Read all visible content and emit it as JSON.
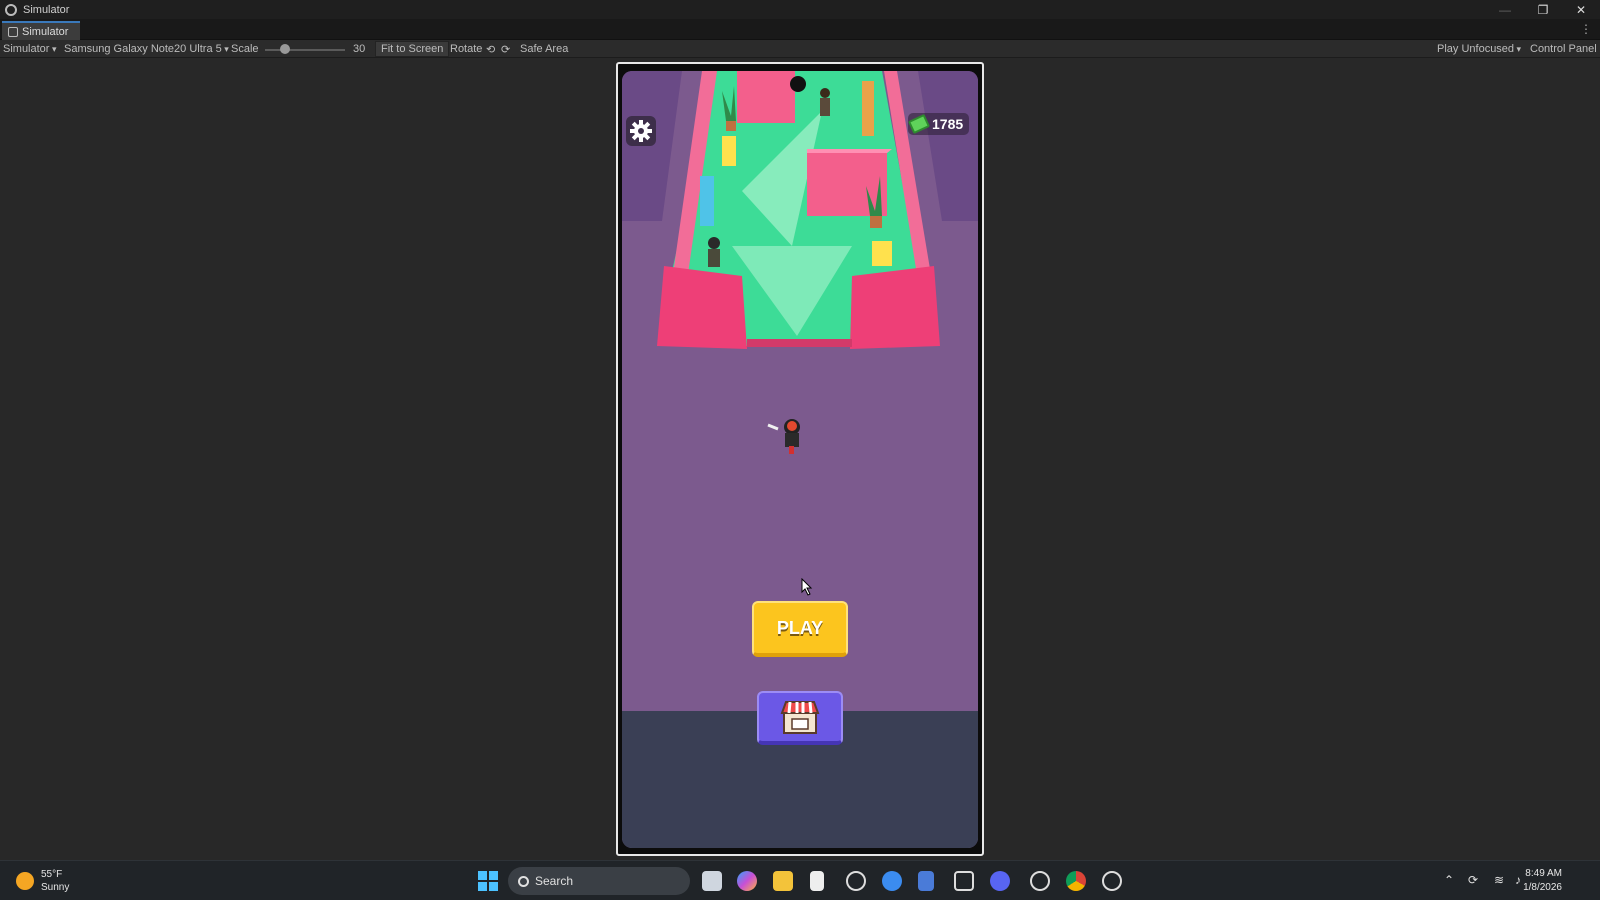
{
  "window": {
    "title": "Simulator"
  },
  "tabs": [
    {
      "label": "Simulator"
    }
  ],
  "toolbar": {
    "simulator_menu": "Simulator",
    "device": "Samsung Galaxy Note20 Ultra 5",
    "scale_label": "Scale",
    "scale_value": "30",
    "fit_to_screen": "Fit to Screen",
    "rotate": "Rotate",
    "safe_area": "Safe Area",
    "play_mode": "Play Unfocused",
    "control_panel": "Control Panel"
  },
  "game": {
    "currency_amount": "1785",
    "play_label": "PLAY",
    "icons": {
      "settings": "gear-icon",
      "currency": "cash-icon",
      "shop": "shop-icon"
    }
  },
  "taskbar": {
    "weather_temp": "55°F",
    "weather_desc": "Sunny",
    "search_placeholder": "Search",
    "time": "8:49 AM",
    "date": "1/8/2026"
  },
  "colors": {
    "play_button": "#fcc51e",
    "shop_button": "#6b58e6",
    "floor": "#3ddc97",
    "walls": "#e8437a",
    "background": "#7c5a8e"
  }
}
